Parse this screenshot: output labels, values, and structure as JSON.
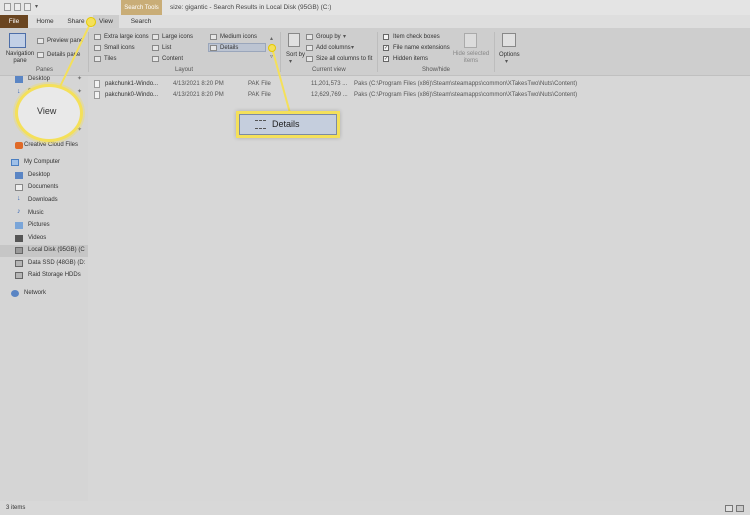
{
  "window": {
    "title": "size: gigantic - Search Results in Local Disk (95GB) (C:)",
    "context_tab": "Search Tools"
  },
  "tabs": [
    {
      "label": "File"
    },
    {
      "label": "Home"
    },
    {
      "label": "Share"
    },
    {
      "label": "View"
    },
    {
      "label": "Search"
    }
  ],
  "ribbon": {
    "panes": {
      "navigation_pane": "Navigation pane",
      "preview_pane": "Preview pane",
      "details_pane": "Details pane",
      "label": "Panes"
    },
    "layout": {
      "extra_large_icons": "Extra large icons",
      "large_icons": "Large icons",
      "medium_icons": "Medium icons",
      "small_icons": "Small icons",
      "list": "List",
      "details": "Details",
      "tiles": "Tiles",
      "content": "Content",
      "label": "Layout"
    },
    "current_view": {
      "sort_by": "Sort by",
      "group_by": "Group by",
      "add_columns": "Add columns",
      "size_all_columns": "Size all columns to fit",
      "label": "Current view"
    },
    "show_hide": {
      "item_check_boxes": "Item check boxes",
      "item_check_boxes_checked": false,
      "file_name_extensions": "File name extensions",
      "file_name_extensions_checked": true,
      "hidden_items": "Hidden items",
      "hidden_items_checked": true,
      "hide_selected_items": "Hide selected items",
      "label": "Show/hide"
    },
    "options": "Options"
  },
  "nav": {
    "quick_access_partial": [
      {
        "label": "Desktop"
      },
      {
        "label": "Do"
      }
    ],
    "creative_cloud": "Creative Cloud Files",
    "my_computer": "My Computer",
    "items": [
      {
        "label": "Desktop"
      },
      {
        "label": "Documents"
      },
      {
        "label": "Downloads"
      },
      {
        "label": "Music"
      },
      {
        "label": "Pictures"
      },
      {
        "label": "Videos"
      },
      {
        "label": "Local Disk (95GB) (C"
      },
      {
        "label": "Data SSD (48GB) (D:"
      },
      {
        "label": "Raid Storage HDDs"
      }
    ],
    "network": "Network"
  },
  "files": [
    {
      "name": "pakchunk1-Windo...",
      "date": "4/13/2021 8:20 PM",
      "type": "PAK File",
      "size": "11,201,573 ...",
      "folder": "Paks (C:\\Program Files (x86)\\Steam\\steamapps\\common\\XTakesTwo\\Nuts\\Content)"
    },
    {
      "name": "pakchunk0-Windo...",
      "date": "4/13/2021 8:20 PM",
      "type": "PAK File",
      "size": "12,629,769 ...",
      "folder": "Paks (C:\\Program Files (x86)\\Steam\\steamapps\\common\\XTakesTwo\\Nuts\\Content)"
    }
  ],
  "status": {
    "items": "3 items"
  },
  "callouts": {
    "view": "View",
    "details": "Details"
  }
}
